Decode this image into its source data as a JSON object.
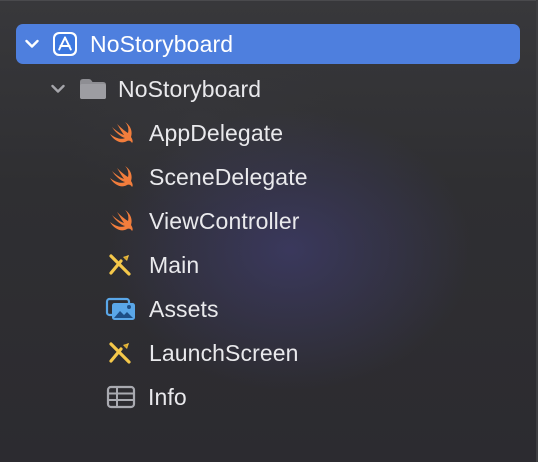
{
  "navigator": {
    "project": {
      "label": "NoStoryboard",
      "icon": "app-project-icon",
      "expanded": true,
      "selected": true
    },
    "group": {
      "label": "NoStoryboard",
      "icon": "folder-icon",
      "expanded": true
    },
    "files": [
      {
        "label": "AppDelegate",
        "icon": "swift-icon"
      },
      {
        "label": "SceneDelegate",
        "icon": "swift-icon"
      },
      {
        "label": "ViewController",
        "icon": "swift-icon"
      },
      {
        "label": "Main",
        "icon": "storyboard-icon"
      },
      {
        "label": "Assets",
        "icon": "assets-catalog-icon"
      },
      {
        "label": "LaunchScreen",
        "icon": "storyboard-icon"
      },
      {
        "label": "Info",
        "icon": "plist-table-icon"
      }
    ]
  },
  "colors": {
    "selection": "#4e7fde",
    "swift": "#f27d3c",
    "storyboard": "#f5c84a",
    "folder": "#8e8e93",
    "assets": "#5aa7e8"
  }
}
